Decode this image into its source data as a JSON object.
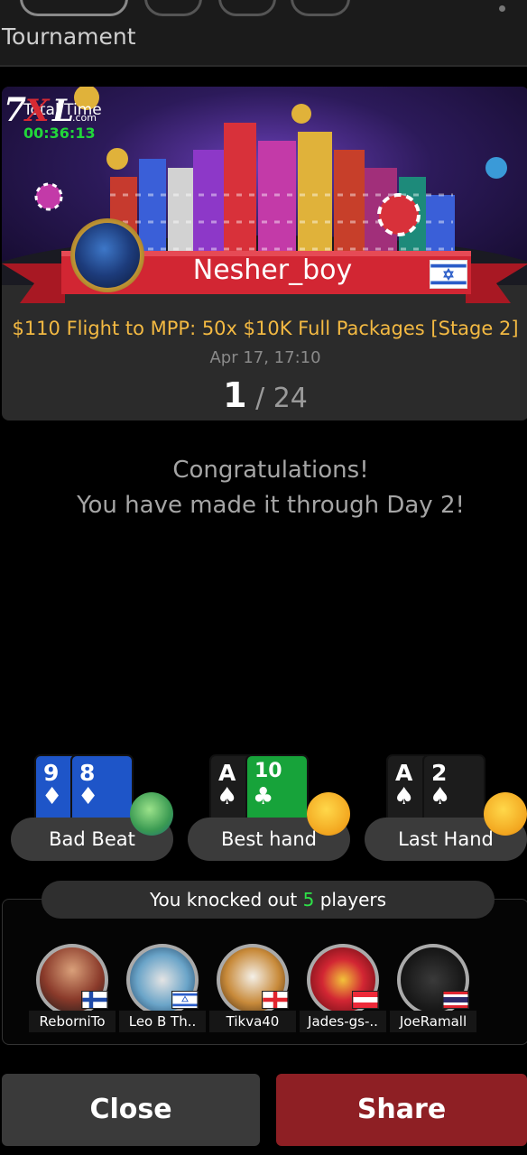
{
  "header": {
    "title": "Tournament"
  },
  "banner": {
    "total_time_label": "Total Time",
    "total_time_value": "00:36:13",
    "player_name": "Nesher_boy",
    "player_flag": "israel-flag",
    "brand": "7XL.com"
  },
  "tournament": {
    "name": "$110 Flight to MPP: 50x $10K Full Packages [Stage 2]",
    "date": "Apr 17, 17:10",
    "position": "1",
    "total": "/ 24"
  },
  "message": {
    "line1": "Congratulations!",
    "line2": "You have made it through Day 2!"
  },
  "hands": [
    {
      "label": "Bad Beat",
      "cards": [
        "9",
        "8"
      ],
      "suit": "♦",
      "emoji": "sick-face"
    },
    {
      "label": "Best hand",
      "cards": [
        "A",
        "10"
      ],
      "suit": "♠ ♣",
      "emoji": "thinking-face"
    },
    {
      "label": "Last Hand",
      "cards": [
        "A",
        "2"
      ],
      "suit": "♠",
      "emoji": "facepalm-face"
    }
  ],
  "knockouts": {
    "prefix": "You knocked out",
    "count": "5",
    "suffix": "players",
    "players": [
      {
        "name": "ReborniTo",
        "flag": "finland-flag"
      },
      {
        "name": "Leo B Th..",
        "flag": "israel-flag"
      },
      {
        "name": "Tikva40",
        "flag": "georgia-flag"
      },
      {
        "name": "Jades-gs-..",
        "flag": "austria-flag"
      },
      {
        "name": "JoeRamall",
        "flag": "thailand-flag"
      }
    ]
  },
  "buttons": {
    "close": "Close",
    "share": "Share"
  },
  "colors": {
    "timer": "#21d63a",
    "tournament_name": "#f3b942",
    "share": "#8e1f24",
    "ko_count": "#2ee148"
  }
}
